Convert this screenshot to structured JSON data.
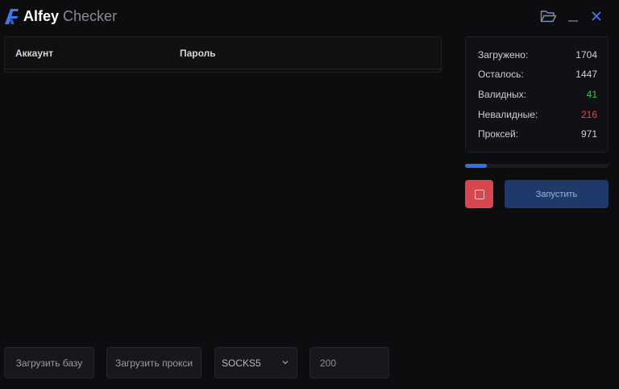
{
  "app": {
    "title_bold": "Alfey",
    "title_light": "Checker",
    "icons": {
      "logo": "alfey-logo",
      "folder": "folder-open-icon",
      "minimize": "minimize-icon",
      "close": "close-icon"
    },
    "colors": {
      "accent": "#2e74e6",
      "danger": "#d9474e",
      "success": "#3cc35f",
      "background": "#0d0d10"
    }
  },
  "table": {
    "columns": [
      "Аккаунт",
      "Пароль"
    ],
    "rows": []
  },
  "stats": {
    "loaded": {
      "label": "Загружено:",
      "value": "1704"
    },
    "remaining": {
      "label": "Осталось:",
      "value": "1447"
    },
    "valid": {
      "label": "Валидных:",
      "value": "41"
    },
    "invalid": {
      "label": "Невалидные:",
      "value": "216"
    },
    "proxies": {
      "label": "Проксей:",
      "value": "971"
    }
  },
  "progress": {
    "percent": 15
  },
  "actions": {
    "start_label": "Запустить"
  },
  "bottom": {
    "load_db_label": "Загрузить базу",
    "load_proxy_label": "Загрузить прокси",
    "proxy_type": "SOCKS5",
    "threads": "200"
  }
}
